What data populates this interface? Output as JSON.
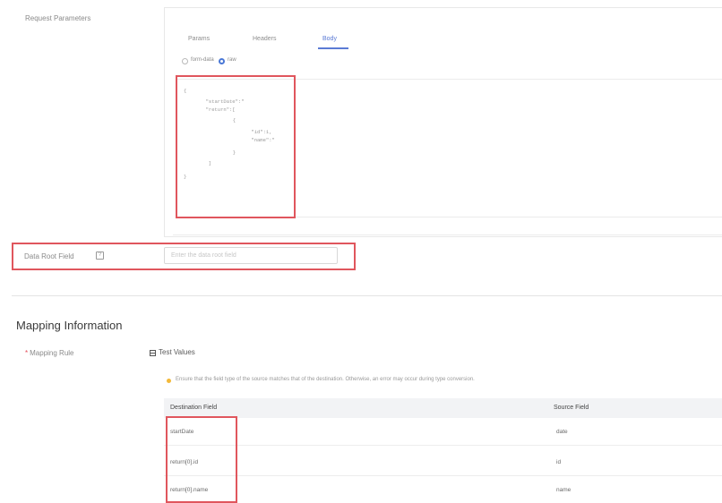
{
  "request": {
    "label": "Request Parameters",
    "tabs": [
      {
        "label": "Params"
      },
      {
        "label": "Headers"
      },
      {
        "label": "Body"
      }
    ],
    "body_type": {
      "options": [
        {
          "label": "form-data",
          "selected": false
        },
        {
          "label": "raw",
          "selected": true
        }
      ]
    },
    "code_lines": [
      "{",
      "  \"startDate\":\"",
      "  \"return\":[",
      "      {",
      "        \"id\":1,",
      "        \"name\":\"",
      "      }",
      "  ]",
      "}"
    ]
  },
  "data_root": {
    "label": "Data Root Field",
    "placeholder": "Enter the data root field"
  },
  "mapping": {
    "title": "Mapping Information",
    "rules_label": "Mapping Rule",
    "test_values_label": "Test Values",
    "tip": "Ensure that the field type of the source matches that of the destination. Otherwise, an error may occur during type conversion.",
    "columns": [
      "Destination Field",
      "Source Field"
    ],
    "rows": [
      {
        "destination": "startDate",
        "source": "date"
      },
      {
        "destination": "return[0].id",
        "source": "id"
      },
      {
        "destination": "return[0].name",
        "source": "name"
      }
    ]
  },
  "colors": {
    "accent": "#5b7bd5",
    "highlight_border": "#e0565d",
    "warning": "#f3b93a"
  }
}
